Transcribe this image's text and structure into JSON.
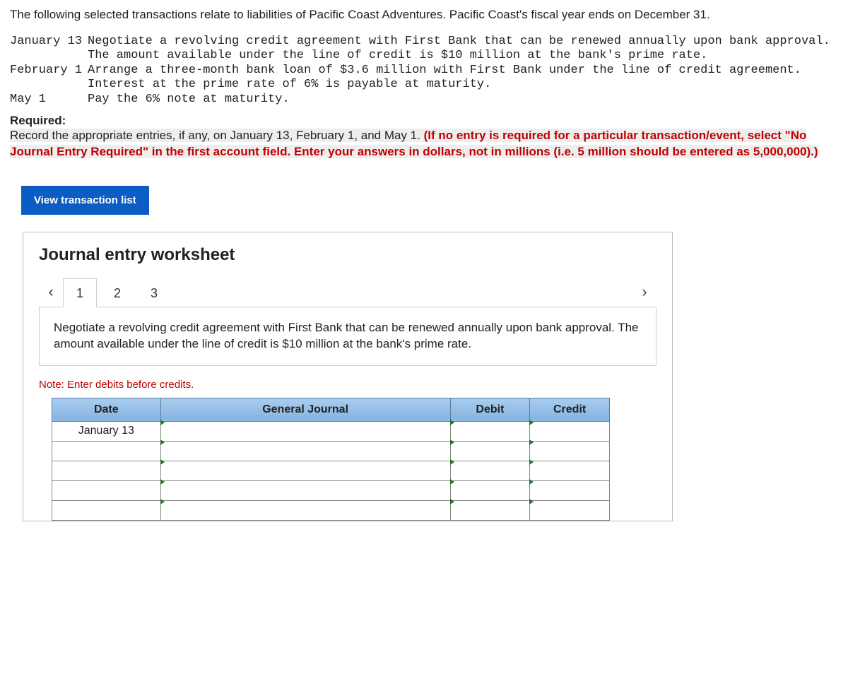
{
  "intro": "The following selected transactions relate to liabilities of Pacific Coast Adventures. Pacific Coast's fiscal year ends on December 31.",
  "transactions": [
    {
      "date": "January 13",
      "text": "Negotiate a revolving credit agreement with First Bank that can be renewed annually upon bank approval. The amount available under the line of credit is $10 million at the bank's prime rate."
    },
    {
      "date": "February 1",
      "text": "Arrange a three-month bank loan of $3.6 million with First Bank under the line of credit agreement. Interest at the prime rate of 6% is payable at maturity."
    },
    {
      "date": "May 1",
      "text": "Pay the 6% note at maturity."
    }
  ],
  "required": {
    "label": "Required:",
    "lead": "Record the appropriate entries, if any, on January 13, February 1, and May 1. ",
    "emph": "(If no entry is required for a particular transaction/event, select \"No Journal Entry Required\" in the first account field. Enter your answers in dollars, not in millions (i.e. 5 million should be entered as 5,000,000).)"
  },
  "view_btn": "View transaction list",
  "worksheet": {
    "title": "Journal entry worksheet",
    "tabs": [
      "1",
      "2",
      "3"
    ],
    "active_tab": 0,
    "description": "Negotiate a revolving credit agreement with First Bank that can be renewed annually upon bank approval. The amount available under the line of credit is $10 million at the bank's prime rate.",
    "note": "Note: Enter debits before credits.",
    "headers": {
      "date": "Date",
      "gj": "General Journal",
      "debit": "Debit",
      "credit": "Credit"
    },
    "rows": [
      {
        "date": "January 13",
        "gj": "",
        "debit": "",
        "credit": ""
      },
      {
        "date": "",
        "gj": "",
        "debit": "",
        "credit": ""
      },
      {
        "date": "",
        "gj": "",
        "debit": "",
        "credit": ""
      },
      {
        "date": "",
        "gj": "",
        "debit": "",
        "credit": ""
      },
      {
        "date": "",
        "gj": "",
        "debit": "",
        "credit": ""
      }
    ]
  }
}
